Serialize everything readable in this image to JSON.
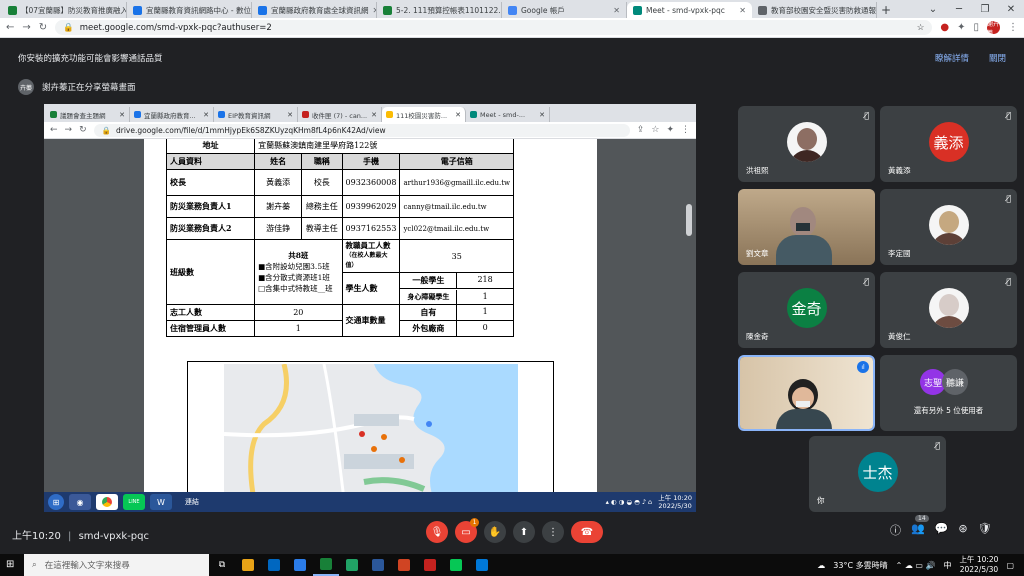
{
  "browser": {
    "tabs": [
      {
        "label": "【07宜蘭縣】防災教育推廣融入...",
        "color": "#188038"
      },
      {
        "label": "宜蘭縣教育資訊網路中心 - 數位...",
        "color": "#1a73e8"
      },
      {
        "label": "宜蘭縣政府教育處全球資訊網",
        "color": "#1a73e8"
      },
      {
        "label": "5-2. 111預算控帳表1101122...",
        "color": "#188038"
      },
      {
        "label": "Google 帳戶",
        "color": "#4285f4"
      },
      {
        "label": "Meet - smd-vpxk-pqc",
        "color": "#00897b",
        "active": true
      },
      {
        "label": "教育部校園安全暨災害防救通報...",
        "color": "#5f6368"
      }
    ],
    "url": "meet.google.com/smd-vpxk-pqc?authuser=2",
    "profile": "謝卉蓁"
  },
  "banner": {
    "text": "你安裝的擴充功能可能會影響通話品質",
    "learn_more": "瞭解詳情",
    "dismiss": "關閉"
  },
  "presenting": {
    "avatar": "卉蓁",
    "text": "謝卉蓁正在分享螢幕畫面"
  },
  "shared": {
    "tabs": [
      {
        "label": "議題會查主題網",
        "color": "#188038"
      },
      {
        "label": "宜蘭縣政府教育...",
        "color": "#1a73e8"
      },
      {
        "label": "EIP教育資訊網",
        "color": "#1a73e8"
      },
      {
        "label": "收件匣 (7) - can...",
        "color": "#c5221f"
      },
      {
        "label": "111校園災害防...",
        "color": "#fbbc04",
        "active": true
      },
      {
        "label": "Meet - smd-...",
        "color": "#00897b"
      }
    ],
    "url": "drive.google.com/file/d/1mmHjypEk6S8ZKUyzqKHm8fL4p6nK42Ad/view",
    "doc": {
      "address_label": "地址",
      "address": "宜蘭縣蘇澳鎮南建里學府路122號",
      "h_personnel": "人員資料",
      "h_name": "姓名",
      "h_title": "職稱",
      "h_phone": "手機",
      "h_email": "電子信箱",
      "r1": {
        "role": "校長",
        "name": "黃義添",
        "title": "校長",
        "phone": "0932360008",
        "email": "arthur1936@gmaill.ilc.edu.tw"
      },
      "r2": {
        "role": "防災業務負責人1",
        "name": "謝卉蓁",
        "title": "總務主任",
        "phone": "0939962029",
        "email": "canny@tmail.ilc.edu.tw"
      },
      "r3": {
        "role": "防災業務負責人2",
        "name": "游佳錚",
        "title": "教導主任",
        "phone": "0937162553",
        "email": "ycl022@tmail.ilc.edu.tw"
      },
      "classes_label": "班級數",
      "classes_total": "共8班",
      "classes_preschool": "■含附設幼兒園3.5班",
      "classes_resource": "■含分散式資源班1班",
      "classes_special": "□含集中式特教班__班",
      "staff_label": "教職員工人數",
      "staff_sub": "（在校人數最大值）",
      "staff_value": "35",
      "students_label": "學生人數",
      "general_label": "一般學生",
      "general_value": "218",
      "disabled_label": "身心障礙學生",
      "disabled_value": "1",
      "volunteer_label": "志工人數",
      "volunteer_value": "20",
      "transport_label": "交通車數量",
      "own_label": "自有",
      "own_value": "1",
      "outsourced_label": "外包廠商",
      "outsourced_value": "0",
      "dorm_label": "住宿管理員人數",
      "dorm_value": "1"
    },
    "taskbar": {
      "input_label": "連結",
      "time": "上午 10:20",
      "date": "2022/5/30"
    }
  },
  "participants": [
    {
      "name": "洪祖熙",
      "type": "photo",
      "muted": true
    },
    {
      "name": "黃義添",
      "type": "avatar",
      "initial": "義添",
      "color": "#d93025",
      "muted": true
    },
    {
      "name": "劉文章",
      "type": "video",
      "muted": false
    },
    {
      "name": "李定國",
      "type": "photo",
      "muted": true
    },
    {
      "name": "陳金奇",
      "type": "avatar",
      "initial": "金奇",
      "color": "#0b8043",
      "muted": true
    },
    {
      "name": "黃俊仁",
      "type": "photo",
      "muted": true
    },
    {
      "name": "",
      "type": "video-speaking",
      "muted": false
    },
    {
      "name": "還有另外 5 位使用者",
      "type": "group",
      "a1": "志聖",
      "a2": "聽謙"
    },
    {
      "name": "你",
      "type": "avatar",
      "initial": "士杰",
      "color": "#00838f",
      "muted": true
    }
  ],
  "meeting": {
    "time": "上午10:20",
    "code": "smd-vpxk-pqc",
    "people_count": "14",
    "reactions_badge": "1"
  },
  "windows": {
    "search_placeholder": "在這裡輸入文字來搜尋",
    "weather": "33°C 多雲時晴",
    "time": "上午 10:20",
    "date": "2022/5/30",
    "ime": "中",
    "app_colors": [
      "#e8a317",
      "#0067c0",
      "#2b7de9",
      "#188038",
      "#21a366",
      "#2b579a",
      "#d04423",
      "#c5221f",
      "#06c755",
      "#0078d7"
    ]
  }
}
